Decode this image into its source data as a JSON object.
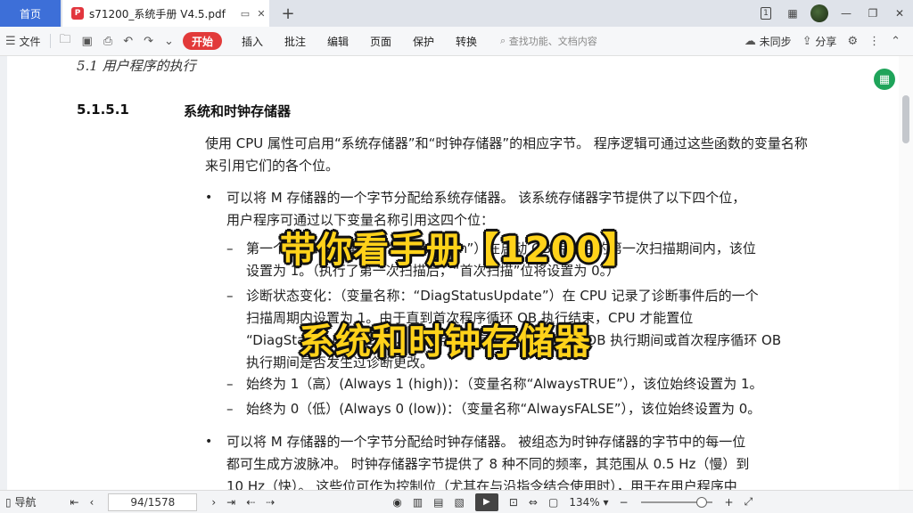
{
  "tabbar": {
    "home_label": "首页",
    "doc_tab_title": "s71200_系统手册 V4.5.pdf",
    "pdf_icon_letter": "P",
    "new_tab": "+",
    "badge": "1"
  },
  "toolbar": {
    "file_label": "文件",
    "start_label": "开始",
    "menus": [
      "插入",
      "批注",
      "编辑",
      "页面",
      "保护",
      "转换"
    ],
    "search_placeholder": "查找功能、文档内容",
    "sync_label": "未同步",
    "share_label": "分享"
  },
  "document": {
    "running_head": "5.1 用户程序的执行",
    "section_number": "5.1.5.1",
    "section_title": "系统和时钟存储器",
    "intro": "使用 CPU 属性可启用“系统存储器”和“时钟存储器”的相应字节。 程序逻辑可通过这些函数的变量名称来引用它们的各个位。",
    "bullet1_line1": "可以将 M 存储器的一个字节分配给系统存储器。 该系统存储器字节提供了以下四个位，",
    "bullet1_line2": "用户程序可通过以下变量名称引用这四个位：",
    "dash1_line1": "第一个循环：（变量名称：“FirstScan”）在启动 OB 完成后的第一次扫描期间内，该位",
    "dash1_line2": "设置为 1。（执行了第一次扫描后，“首次扫描”位将设置为 0。）",
    "dash2_line1": "诊断状态变化：（变量名称：“DiagStatusUpdate”）在 CPU 记录了诊断事件后的一个",
    "dash2_line2": "扫描周期内设置为 1。由于直到首次程序循环 OB 执行结束，CPU 才能置位",
    "dash2_line3": "“DiagStatusUpdate”位，因此用户程序无法检测在启动 OB 执行期间或首次程序循环 OB",
    "dash2_line4": "执行期间是否发生过诊断更改。",
    "dash3": "始终为 1（高）(Always 1 (high))：（变量名称“AlwaysTRUE”），该位始终设置为 1。",
    "dash4": "始终为 0（低）(Always 0 (low))：（变量名称“AlwaysFALSE”），该位始终设置为 0。",
    "bullet2_line1": "可以将 M 存储器的一个字节分配给时钟存储器。 被组态为时钟存储器的字节中的每一位",
    "bullet2_line2": "都可生成方波脉冲。 时钟存储器字节提供了 8 种不同的频率，其范围从 0.5 Hz（慢）到",
    "bullet2_line3": "10 Hz（快）。 这些位可作为控制位（尤其在与沿指令结合使用时），用于在用户程序中",
    "bullet_glyph": "•",
    "dash_glyph": "–"
  },
  "overlay": {
    "line1": "带你看手册【1200】",
    "line2": "系统和时钟存储器"
  },
  "statusbar": {
    "nav_label": "导航",
    "page_indicator": "94/1578",
    "zoom": "134%"
  },
  "colors": {
    "home_tab": "#3d6fd8",
    "start_button": "#e23a3a",
    "overlay_text": "#ffd21a",
    "fab": "#1fa45a"
  }
}
